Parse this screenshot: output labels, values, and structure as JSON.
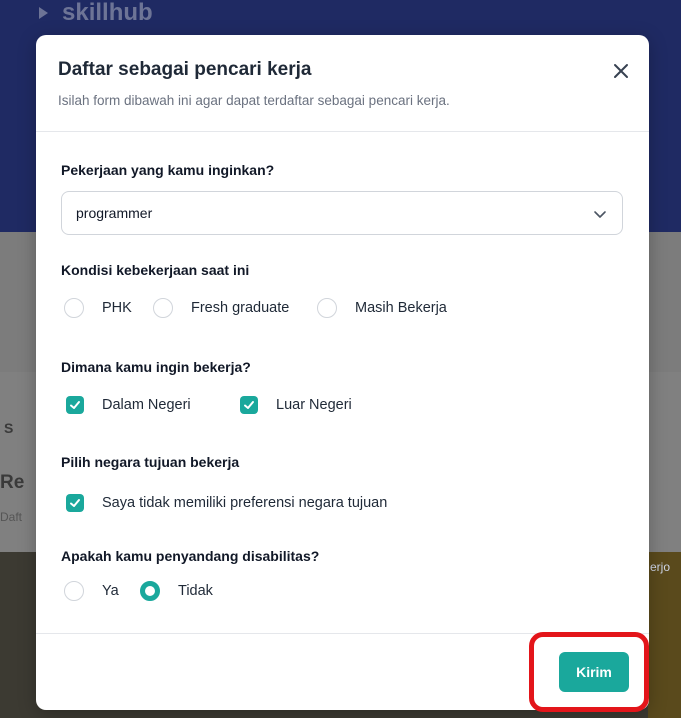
{
  "background": {
    "logo_text": "skillhub",
    "fragments": [
      "S",
      "Re",
      "Daft",
      "erjo"
    ]
  },
  "modal": {
    "title": "Daftar sebagai pencari kerja",
    "subtitle": "Isilah form dibawah ini agar dapat terdaftar sebagai pencari kerja.",
    "close_icon": "close-icon"
  },
  "job": {
    "label": "Pekerjaan yang kamu inginkan?",
    "selected": "programmer"
  },
  "employment": {
    "label": "Kondisi kebekerjaan saat ini",
    "options": [
      {
        "label": "PHK",
        "checked": false
      },
      {
        "label": "Fresh graduate",
        "checked": false
      },
      {
        "label": "Masih Bekerja",
        "checked": false
      }
    ]
  },
  "location": {
    "label": "Dimana kamu ingin bekerja?",
    "options": [
      {
        "label": "Dalam Negeri",
        "checked": true
      },
      {
        "label": "Luar Negeri",
        "checked": true
      }
    ]
  },
  "country": {
    "label": "Pilih negara tujuan bekerja",
    "options": [
      {
        "label": "Saya tidak memiliki preferensi negara tujuan",
        "checked": true
      }
    ]
  },
  "disability": {
    "label": "Apakah kamu penyandang disabilitas?",
    "options": [
      {
        "label": "Ya",
        "checked": false
      },
      {
        "label": "Tidak",
        "checked": true
      }
    ]
  },
  "footer": {
    "submit_label": "Kirim"
  },
  "colors": {
    "accent": "#1aa89c",
    "highlight": "#e3151a"
  }
}
